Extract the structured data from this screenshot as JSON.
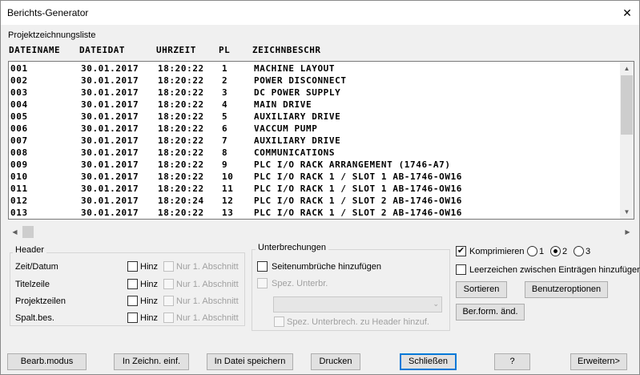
{
  "window": {
    "title": "Berichts-Generator",
    "close_glyph": "✕"
  },
  "list": {
    "label": "Projektzeichnungsliste",
    "columns": [
      "DATEINAME",
      "DATEIDAT",
      "UHRZEIT",
      "PL",
      "ZEICHNBESCHR"
    ],
    "rows": [
      [
        "001",
        "30.01.2017",
        "18:20:22",
        "1",
        "MACHINE LAYOUT"
      ],
      [
        "002",
        "30.01.2017",
        "18:20:22",
        "2",
        "POWER DISCONNECT"
      ],
      [
        "003",
        "30.01.2017",
        "18:20:22",
        "3",
        "DC POWER SUPPLY"
      ],
      [
        "004",
        "30.01.2017",
        "18:20:22",
        "4",
        "MAIN DRIVE"
      ],
      [
        "005",
        "30.01.2017",
        "18:20:22",
        "5",
        "AUXILIARY DRIVE"
      ],
      [
        "006",
        "30.01.2017",
        "18:20:22",
        "6",
        "VACCUM PUMP"
      ],
      [
        "007",
        "30.01.2017",
        "18:20:22",
        "7",
        "AUXILIARY DRIVE"
      ],
      [
        "008",
        "30.01.2017",
        "18:20:22",
        "8",
        "COMMUNICATIONS"
      ],
      [
        "009",
        "30.01.2017",
        "18:20:22",
        "9",
        "PLC I/O RACK ARRANGEMENT (1746-A7)"
      ],
      [
        "010",
        "30.01.2017",
        "18:20:22",
        "10",
        "PLC I/O RACK 1 / SLOT 1  AB-1746-OW16"
      ],
      [
        "011",
        "30.01.2017",
        "18:20:22",
        "11",
        "PLC I/O RACK 1 / SLOT 1  AB-1746-OW16"
      ],
      [
        "012",
        "30.01.2017",
        "18:20:24",
        "12",
        "PLC I/O RACK 1 / SLOT 2  AB-1746-OW16"
      ],
      [
        "013",
        "30.01.2017",
        "18:20:22",
        "13",
        "PLC I/O RACK 1 / SLOT 2  AB-1746-OW16"
      ]
    ]
  },
  "header_group": {
    "title": "Header",
    "rows": [
      {
        "label": "Zeit/Datum",
        "hinz": "Hinz",
        "nur": "Nur 1. Abschnitt"
      },
      {
        "label": "Titelzeile",
        "hinz": "Hinz",
        "nur": "Nur 1. Abschnitt"
      },
      {
        "label": "Projektzeilen",
        "hinz": "Hinz",
        "nur": "Nur 1. Abschnitt"
      },
      {
        "label": "Spalt.bes.",
        "hinz": "Hinz",
        "nur": "Nur 1. Abschnitt"
      }
    ]
  },
  "breaks_group": {
    "title": "Unterbrechungen",
    "page_breaks": "Seitenumbrüche hinzufügen",
    "spec_breaks": "Spez. Unterbr.",
    "spec_to_header": "Spez. Unterbrech. zu Header hinzuf."
  },
  "options": {
    "compress": "Komprimieren",
    "compress_checked": true,
    "radio_options": [
      "1",
      "2",
      "3"
    ],
    "radio_selected": "2",
    "spaces": "Leerzeichen zwischen Einträgen hinzufügen",
    "spaces_checked": false,
    "sort_button": "Sortieren",
    "user_options_button": "Benutzeroptionen",
    "format_button": "Ber.form. änd."
  },
  "bottom_buttons": {
    "edit_mode": "Bearb.modus",
    "insert_drawing": "In Zeichn. einf.",
    "save_file": "In Datei speichern",
    "print": "Drucken",
    "close": "Schließen",
    "help": "?",
    "expand": "Erweitern>"
  },
  "icons": {
    "check": "✔",
    "arrow_up": "▲",
    "arrow_down": "▼",
    "arrow_left": "◀",
    "arrow_right": "▶",
    "combo_drop": "⌄"
  }
}
